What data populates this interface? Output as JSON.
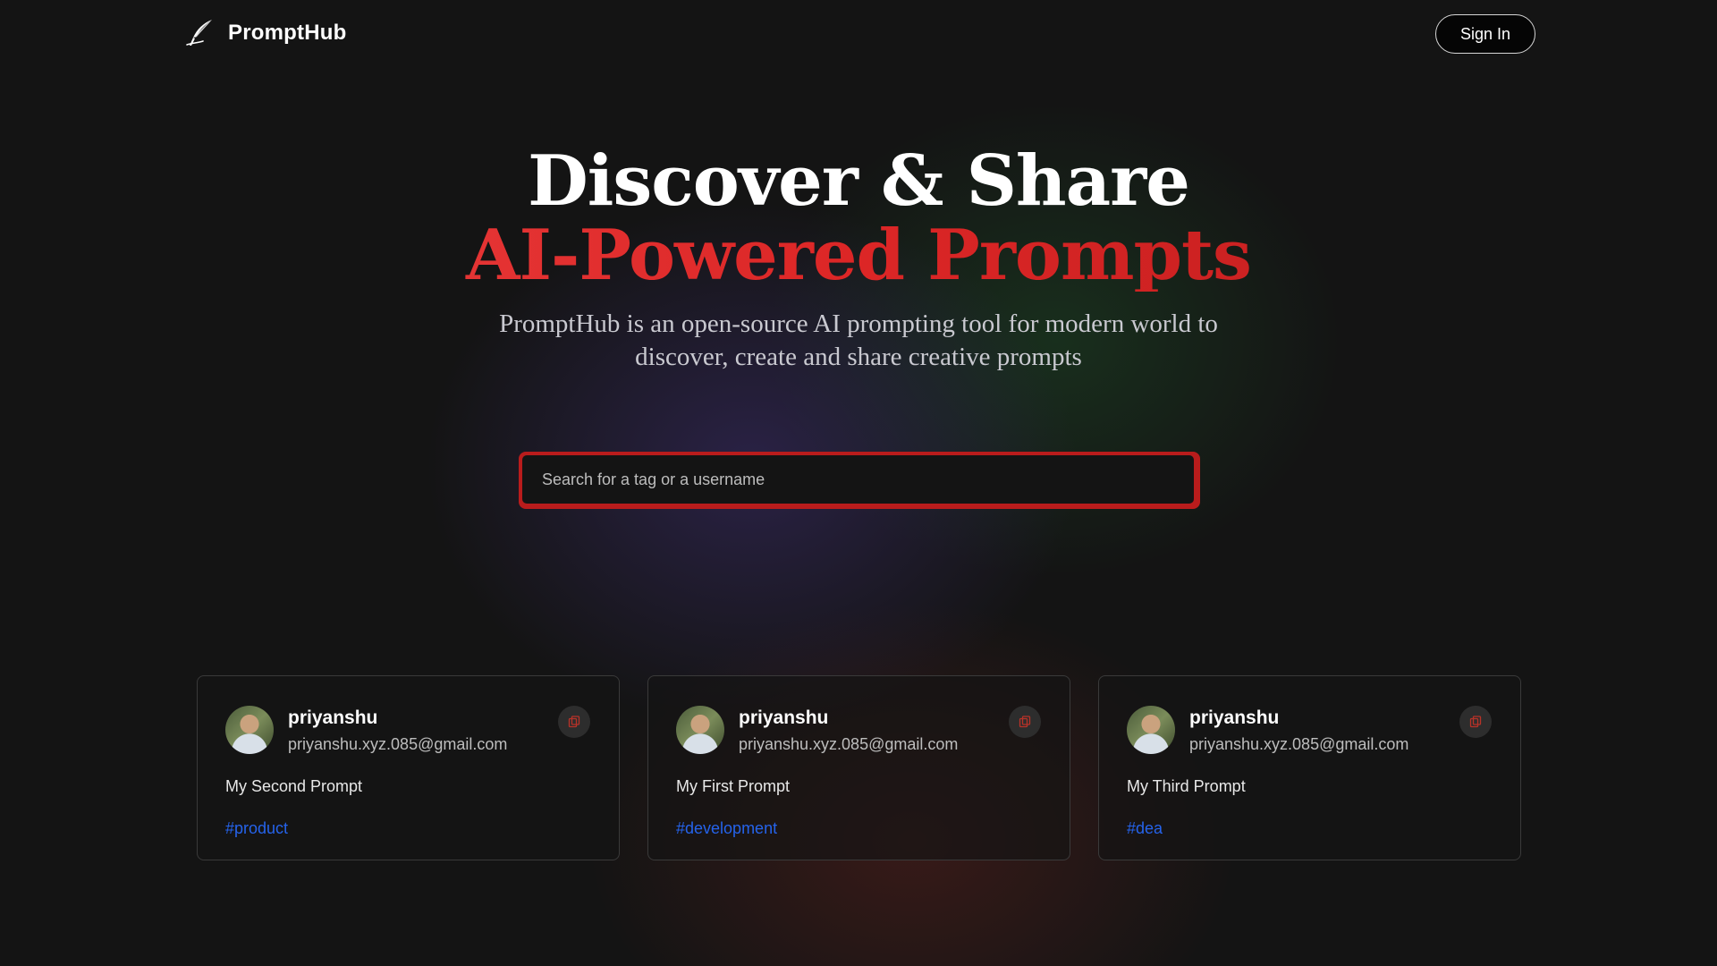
{
  "nav": {
    "brand_name": "PromptHub",
    "brand_icon": "quill-icon",
    "signin_label": "Sign In"
  },
  "hero": {
    "title_line1": "Discover & Share",
    "title_line2": "AI-Powered Prompts",
    "subtitle": "PromptHub is an open-source AI prompting tool for modern world to discover, create and share creative prompts"
  },
  "search": {
    "placeholder": "Search for a tag or a username",
    "value": ""
  },
  "cards": [
    {
      "username": "priyanshu",
      "email": "priyanshu.xyz.085@gmail.com",
      "prompt": "My Second Prompt",
      "tag": "#product",
      "copy_icon": "copy-icon"
    },
    {
      "username": "priyanshu",
      "email": "priyanshu.xyz.085@gmail.com",
      "prompt": "My First Prompt",
      "tag": "#development",
      "copy_icon": "copy-icon"
    },
    {
      "username": "priyanshu",
      "email": "priyanshu.xyz.085@gmail.com",
      "prompt": "My Third Prompt",
      "tag": "#dea",
      "copy_icon": "copy-icon"
    }
  ],
  "colors": {
    "accent_red": "#dc2626",
    "tag_blue": "#2563eb",
    "background": "#141414"
  }
}
